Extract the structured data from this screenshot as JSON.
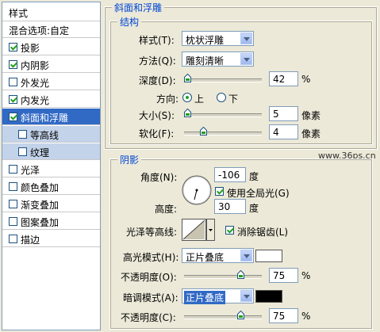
{
  "styles_panel": {
    "header": "样式",
    "items": [
      {
        "label": "混合选项:自定",
        "checkbox": false,
        "checked": false
      },
      {
        "label": "投影",
        "checkbox": true,
        "checked": true
      },
      {
        "label": "内阴影",
        "checkbox": true,
        "checked": true
      },
      {
        "label": "外发光",
        "checkbox": true,
        "checked": false
      },
      {
        "label": "内发光",
        "checkbox": true,
        "checked": true
      },
      {
        "label": "斜面和浮雕",
        "checkbox": true,
        "checked": true,
        "selected": true
      },
      {
        "label": "等高线",
        "checkbox": true,
        "checked": false,
        "sub": true
      },
      {
        "label": "纹理",
        "checkbox": true,
        "checked": false,
        "sub": true
      },
      {
        "label": "光泽",
        "checkbox": true,
        "checked": false
      },
      {
        "label": "颜色叠加",
        "checkbox": true,
        "checked": false
      },
      {
        "label": "渐变叠加",
        "checkbox": true,
        "checked": false
      },
      {
        "label": "图案叠加",
        "checkbox": true,
        "checked": false
      },
      {
        "label": "描边",
        "checkbox": true,
        "checked": false
      }
    ]
  },
  "bevel": {
    "section_title": "斜面和浮雕",
    "structure_title": "结构",
    "style_label": "样式(T):",
    "style_value": "枕状浮雕",
    "technique_label": "方法(Q):",
    "technique_value": "雕刻清晰",
    "depth_label": "深度(D):",
    "depth_value": "42",
    "depth_unit": "%",
    "direction_label": "方向:",
    "direction_up": "上",
    "direction_down": "下",
    "direction_selected": "up",
    "size_label": "大小(S):",
    "size_value": "5",
    "size_unit": "像素",
    "soften_label": "软化(F):",
    "soften_value": "4",
    "soften_unit": "像素"
  },
  "shading": {
    "title": "阴影",
    "angle_label": "角度(N):",
    "angle_value": "-106",
    "angle_unit": "度",
    "global_light_label": "使用全局光(G)",
    "global_light_checked": true,
    "altitude_label": "高度:",
    "altitude_value": "30",
    "altitude_unit": "度",
    "gloss_contour_label": "光泽等高线:",
    "anti_alias_label": "消除锯齿(L)",
    "anti_alias_checked": true,
    "highlight_mode_label": "高光模式(H):",
    "highlight_mode_value": "正片叠底",
    "highlight_color": "#ffffff",
    "highlight_opacity_label": "不透明度(O):",
    "highlight_opacity_value": "75",
    "highlight_opacity_unit": "%",
    "shadow_mode_label": "暗调模式(A):",
    "shadow_mode_value": "正片叠底",
    "shadow_color": "#000000",
    "shadow_opacity_label": "不透明度(C):",
    "shadow_opacity_value": "75",
    "shadow_opacity_unit": "%"
  },
  "watermark": "www.36ps.cn"
}
